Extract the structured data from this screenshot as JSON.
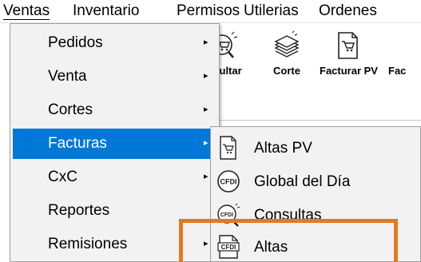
{
  "menubar": {
    "items": [
      "Ventas",
      "Inventario",
      "Permisos",
      "Utilerias",
      "Ordenes"
    ]
  },
  "toolbar": {
    "buttons": [
      {
        "label": "nsultar",
        "icon": "cart-search-icon"
      },
      {
        "label": "Corte",
        "icon": "stack-icon"
      },
      {
        "label": "Facturar PV",
        "icon": "invoice-cart-icon"
      },
      {
        "label": "Fac",
        "icon": "invoice-icon"
      }
    ]
  },
  "ventas_menu": {
    "items": [
      {
        "label": "Pedidos",
        "has_submenu": true
      },
      {
        "label": "Venta",
        "has_submenu": true
      },
      {
        "label": "Cortes",
        "has_submenu": true
      },
      {
        "label": "Facturas",
        "has_submenu": true,
        "highlighted": true
      },
      {
        "label": "CxC",
        "has_submenu": true
      },
      {
        "label": "Reportes",
        "has_submenu": false
      },
      {
        "label": "Remisiones",
        "has_submenu": true
      }
    ],
    "arrow_glyph": "▸"
  },
  "facturas_submenu": {
    "items": [
      {
        "label": "Altas PV",
        "icon": "invoice-cart-icon"
      },
      {
        "label": "Global del Día",
        "icon": "cfdi-badge-icon",
        "badge": "CFDI"
      },
      {
        "label": "Consultas",
        "icon": "cfdi-search-icon",
        "badge": "CFDI"
      },
      {
        "label": "Altas",
        "icon": "cfdi-document-icon",
        "badge": "CFDI"
      }
    ]
  },
  "colors": {
    "highlight": "#0078d7",
    "annotation_box": "#e27b1f",
    "menu_bg": "#f2f2f2"
  }
}
